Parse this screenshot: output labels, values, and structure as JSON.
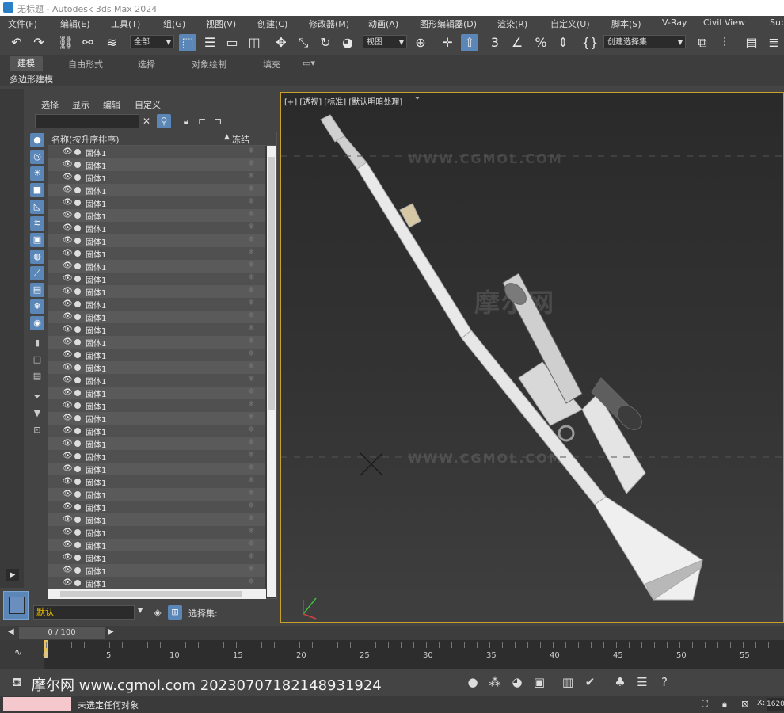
{
  "window": {
    "title": "无标题 - Autodesk 3ds Max 2024"
  },
  "menu": [
    "文件(F)",
    "编辑(E)",
    "工具(T)",
    "组(G)",
    "视图(V)",
    "创建(C)",
    "修改器(M)",
    "动画(A)",
    "图形编辑器(D)",
    "渲染(R)",
    "自定义(U)",
    "脚本(S)",
    "V-Ray",
    "Civil View",
    "Sub"
  ],
  "toolbar": {
    "selection_filter": "全部",
    "ref_coord": "视图",
    "named_selection": "创建选择集"
  },
  "ribbon": {
    "tabs": [
      "建模",
      "自由形式",
      "选择",
      "对象绘制",
      "填充"
    ],
    "active_tab": "建模",
    "sub_label": "多边形建模"
  },
  "explorer": {
    "tabs": [
      "选择",
      "显示",
      "编辑",
      "自定义"
    ],
    "column_name": "名称(按升序排序)",
    "column_freeze": "冻结",
    "object_name": "固体1",
    "row_count": 35,
    "layer": "默认",
    "selection_set_label": "选择集:"
  },
  "viewport": {
    "label": "[+] [透视] [标准] [默认明暗处理]",
    "watermark": "WWW.CGMOL.COM",
    "watermark_cn": "摩尔网"
  },
  "timeline": {
    "frame_display": "0 / 100",
    "ticks": [
      "0",
      "5",
      "10",
      "15",
      "20",
      "25",
      "30",
      "35",
      "40",
      "45",
      "50",
      "55"
    ]
  },
  "bottom": {
    "watermark_text": "摩尔网 www.cgmol.com 20230707182148931924",
    "status": "未选定任何对象",
    "coord_label": "X:",
    "coord_value": "1620"
  },
  "colors": {
    "accent": "#5a86b8",
    "viewport_border": "#c9a227",
    "layer_text": "#f5c400"
  }
}
